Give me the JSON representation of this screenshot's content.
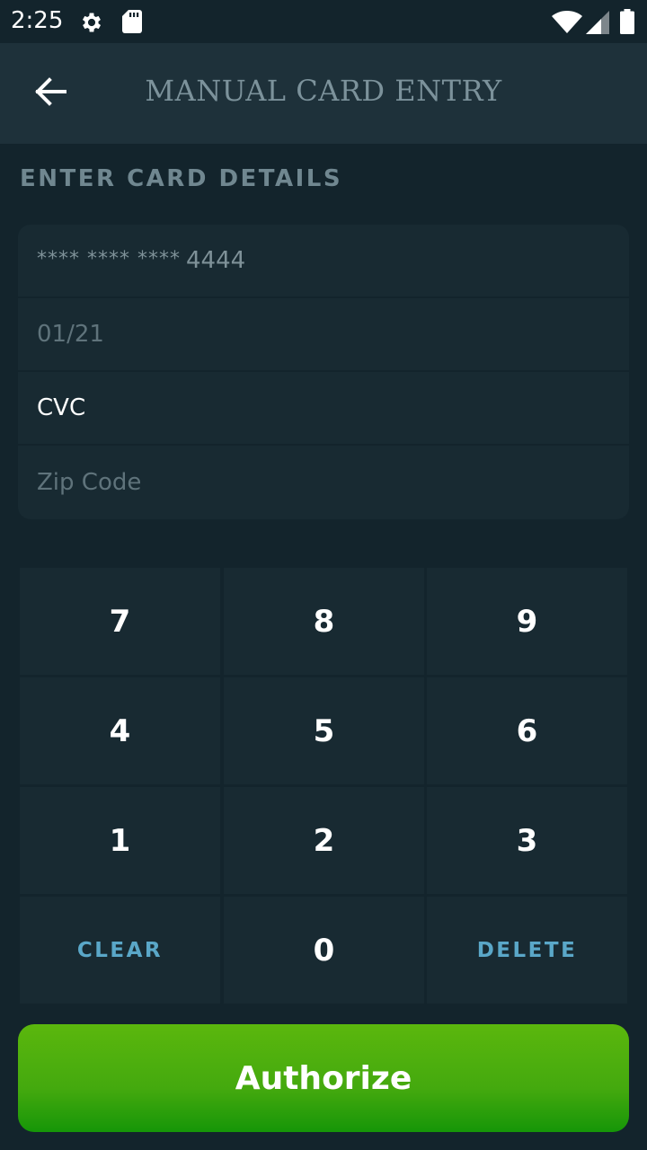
{
  "status_bar": {
    "time": "2:25",
    "left_icons": [
      "gear-icon",
      "sd-card-icon"
    ],
    "right_icons": [
      "wifi-icon",
      "cell-signal-icon",
      "battery-icon"
    ]
  },
  "app_bar": {
    "title": "MANUAL CARD ENTRY",
    "back_icon": "arrow-left-icon"
  },
  "section_label": "ENTER CARD DETAILS",
  "form": {
    "card_number_mask": "**** **** ****",
    "card_number_last4": "4444",
    "expiry": "01/21",
    "cvc_placeholder": "CVC",
    "zip_placeholder": "Zip Code"
  },
  "keypad": {
    "k7": "7",
    "k8": "8",
    "k9": "9",
    "k4": "4",
    "k5": "5",
    "k6": "6",
    "k1": "1",
    "k2": "2",
    "k3": "3",
    "clear": "CLEAR",
    "k0": "0",
    "delete": "DELETE"
  },
  "authorize_label": "Authorize",
  "colors": {
    "background": "#13242c",
    "app_bar": "#1e313a",
    "field_bg": "#182a32",
    "accent_blue": "#5aa7c8",
    "button_green": "#4caf0e"
  }
}
